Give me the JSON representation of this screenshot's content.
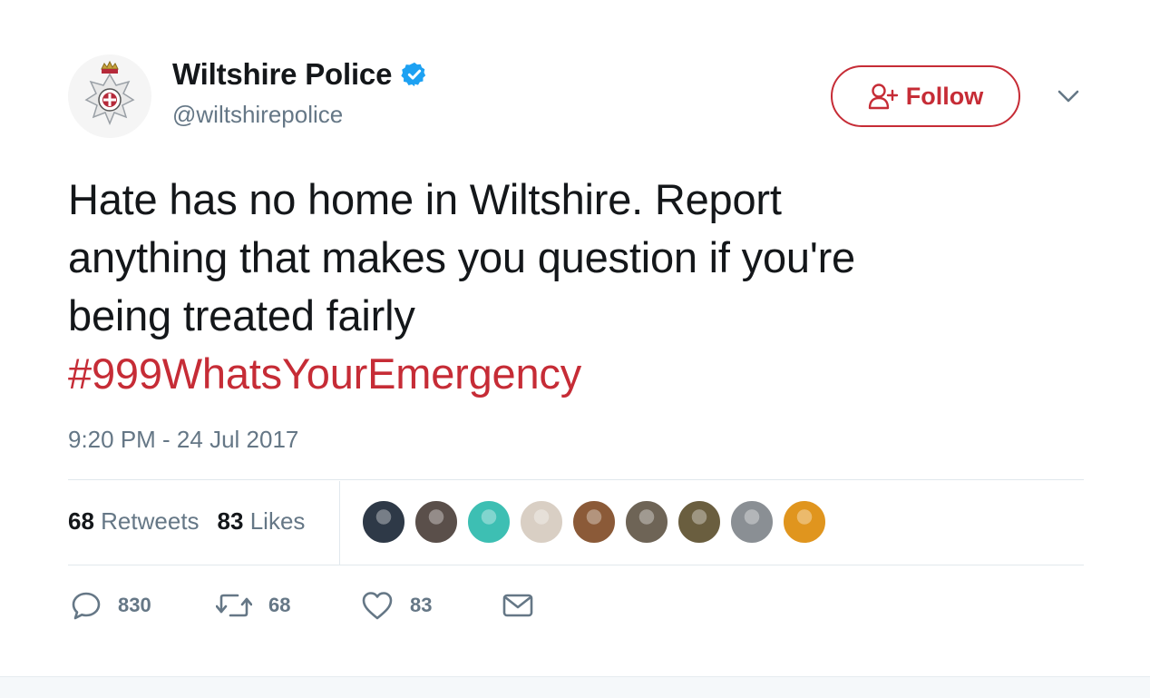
{
  "user": {
    "name": "Wiltshire Police",
    "handle": "@wiltshirepolice",
    "verified": true,
    "avatar_icon": "police-crest-icon"
  },
  "follow_button": {
    "label": "Follow",
    "icon": "add-user-icon"
  },
  "tweet": {
    "line1": "Hate has no home in Wiltshire. Report",
    "line2": "anything that makes you question if you're",
    "line3": "being treated fairly",
    "hashtag": "#999WhatsYourEmergency",
    "timestamp": "9:20 PM - 24 Jul 2017"
  },
  "stats": {
    "retweets_count": "68",
    "retweets_label": "Retweets",
    "likes_count": "83",
    "likes_label": "Likes"
  },
  "likers": [
    {
      "color": "#2e3947"
    },
    {
      "color": "#5a4f4a"
    },
    {
      "color": "#3dbfb3"
    },
    {
      "color": "#d9cfc4"
    },
    {
      "color": "#8b5a38"
    },
    {
      "color": "#6e6456"
    },
    {
      "color": "#6a5e3f"
    },
    {
      "color": "#8a8f94"
    },
    {
      "color": "#e0951e"
    }
  ],
  "actions": {
    "reply_count": "830",
    "retweet_count": "68",
    "like_count": "83"
  },
  "colors": {
    "accent": "#c62c36",
    "verified": "#1da1f2",
    "secondary_text": "#657786"
  }
}
